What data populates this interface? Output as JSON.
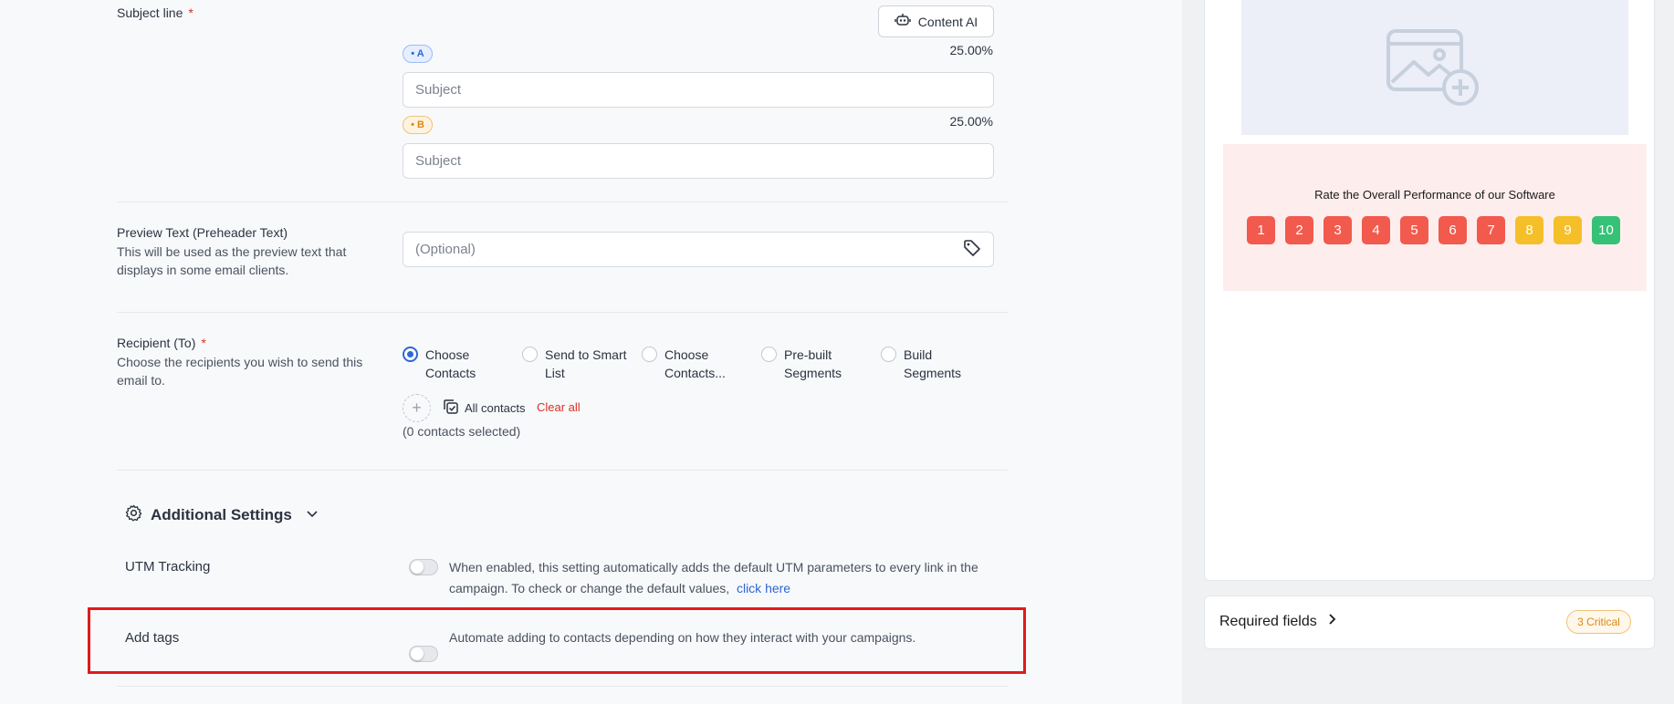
{
  "subject": {
    "label": "Subject line",
    "required_mark": "*",
    "content_ai_label": "Content AI",
    "variant_a": {
      "badge": "• A",
      "percent": "25.00%",
      "placeholder": "Subject"
    },
    "variant_b": {
      "badge": "• B",
      "percent": "25.00%",
      "placeholder": "Subject"
    }
  },
  "preview_text": {
    "label": "Preview Text (Preheader Text)",
    "description": "This will be used as the preview text that displays in some email clients.",
    "placeholder": "(Optional)"
  },
  "recipient": {
    "label": "Recipient (To)",
    "required_mark": "*",
    "description": "Choose the recipients you wish to send this email to.",
    "options": [
      {
        "label": "Choose Contacts",
        "selected": true
      },
      {
        "label": "Send to Smart List",
        "selected": false
      },
      {
        "label": "Choose Contacts...",
        "selected": false
      },
      {
        "label": "Pre-built Segments",
        "selected": false
      },
      {
        "label": "Build Segments",
        "selected": false
      }
    ],
    "all_contacts_label": "All contacts",
    "clear_all_label": "Clear all",
    "selected_count": "(0 contacts selected)"
  },
  "additional_settings": {
    "title": "Additional Settings",
    "utm": {
      "label": "UTM Tracking",
      "enabled": false,
      "description": "When enabled, this setting automatically adds the default UTM parameters to every link in the campaign. To check or change the default values,",
      "link_label": "click here"
    },
    "tags": {
      "label": "Add tags",
      "enabled": false,
      "description": "Automate adding to contacts depending on how they interact with your campaigns."
    }
  },
  "preview": {
    "rating_title": "Rate the Overall Performance of our Software",
    "rating_values": [
      "1",
      "2",
      "3",
      "4",
      "5",
      "6",
      "7",
      "8",
      "9",
      "10"
    ],
    "rating_colors": [
      "#f25a4d",
      "#f25a4d",
      "#f25a4d",
      "#f25a4d",
      "#f25a4d",
      "#f25a4d",
      "#f25a4d",
      "#f5bf2a",
      "#f5bf2a",
      "#35c277"
    ]
  },
  "required_fields": {
    "label": "Required fields",
    "badge": "3 Critical"
  },
  "colors": {
    "accent": "#2f66d8",
    "danger": "#d93025",
    "highlight": "#e01b1b"
  }
}
